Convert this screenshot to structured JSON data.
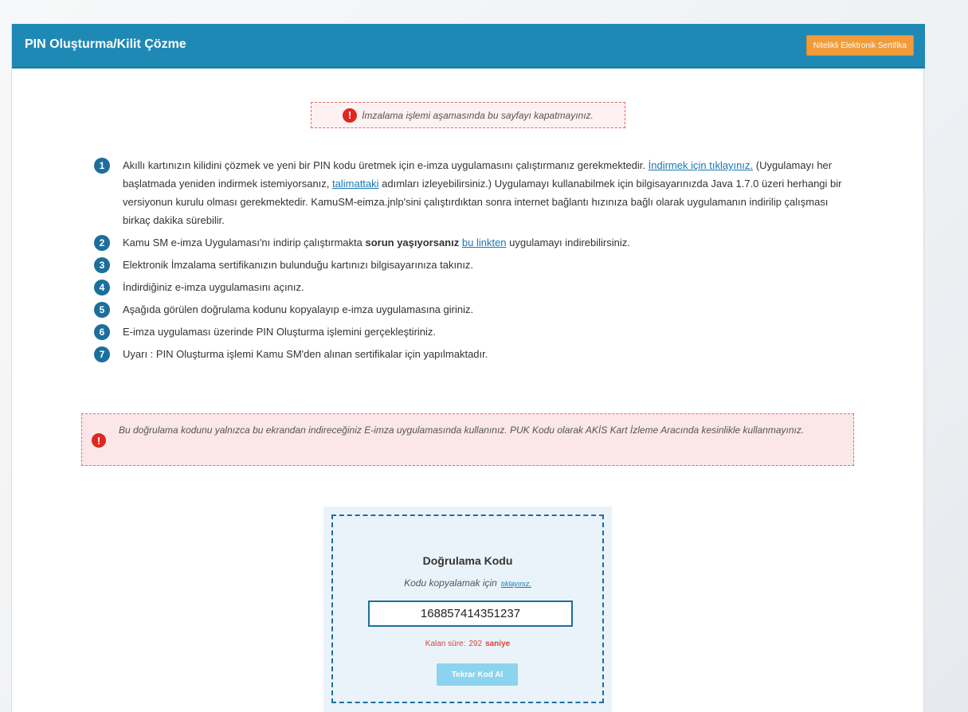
{
  "header": {
    "title": "PIN Oluşturma/Kilit Çözme",
    "cert_button": "Nitelikli Elektronik Sertifika"
  },
  "warning_top": "İmzalama işlemi aşamasında bu sayfayı kapatmayınız.",
  "steps": [
    {
      "num": "1",
      "t1": "Akıllı kartınızın kilidini çözmek ve yeni bir PIN kodu üretmek için e-imza uygulamasını çalıştırmanız gerekmektedir. ",
      "link1": "İndirmek için tıklayınız.",
      "t2": " (Uygulamayı her başlatmada yeniden indirmek istemiyorsanız, ",
      "link2": "talimattaki",
      "t3": " adımları izleyebilirsiniz.) Uygulamayı kullanabilmek için bilgisayarınızda Java 1.7.0 üzeri herhangi bir versiyonun kurulu olması gerekmektedir. KamuSM-eimza.jnlp'sini çalıştırdıktan sonra internet bağlantı hızınıza bağlı olarak uygulamanın indirilip çalışması birkaç dakika sürebilir."
    },
    {
      "num": "2",
      "t1": "Kamu SM e-imza Uygulaması'nı indirip çalıştırmakta ",
      "bold": "sorun yaşıyorsanız",
      "t2": " ",
      "link": "bu linkten",
      "t3": " uygulamayı indirebilirsiniz."
    },
    {
      "num": "3",
      "text": "Elektronik İmzalama sertifikanızın bulunduğu kartınızı bilgisayarınıza takınız."
    },
    {
      "num": "4",
      "text": "İndirdiğiniz e-imza uygulamasını açınız."
    },
    {
      "num": "5",
      "text": "Aşağıda görülen doğrulama kodunu kopyalayıp e-imza uygulamasına giriniz."
    },
    {
      "num": "6",
      "text": "E-imza uygulaması üzerinde PIN Oluşturma işlemini gerçekleştiriniz."
    },
    {
      "num": "7",
      "text": "Uyarı : PIN Oluşturma işlemi Kamu SM'den alınan sertifikalar için yapılmaktadır."
    }
  ],
  "warning_bottom": "Bu doğrulama kodunu yalnızca bu ekrandan indireceğiniz E-imza uygulamasında kullanınız. PUK Kodu olarak AKİS Kart İzleme Aracında kesinlikle kullanmayınız.",
  "code_box": {
    "title": "Doğrulama Kodu",
    "copy_text": "Kodu kopyalamak için",
    "copy_link": "tıklayınız.",
    "code_value": "168857414351237",
    "timer_label": "Kalan süre:",
    "timer_seconds": "292",
    "timer_unit": "saniye",
    "retry_button": "Tekrar Kod Al"
  },
  "colors": {
    "header_bg": "#1f89b5",
    "cert_button_bg": "#f29b38",
    "step_badge": "#1c6f9d",
    "alert_red": "#e0271f",
    "link": "#1877b5",
    "retry_button_bg": "#8bd3ee"
  }
}
